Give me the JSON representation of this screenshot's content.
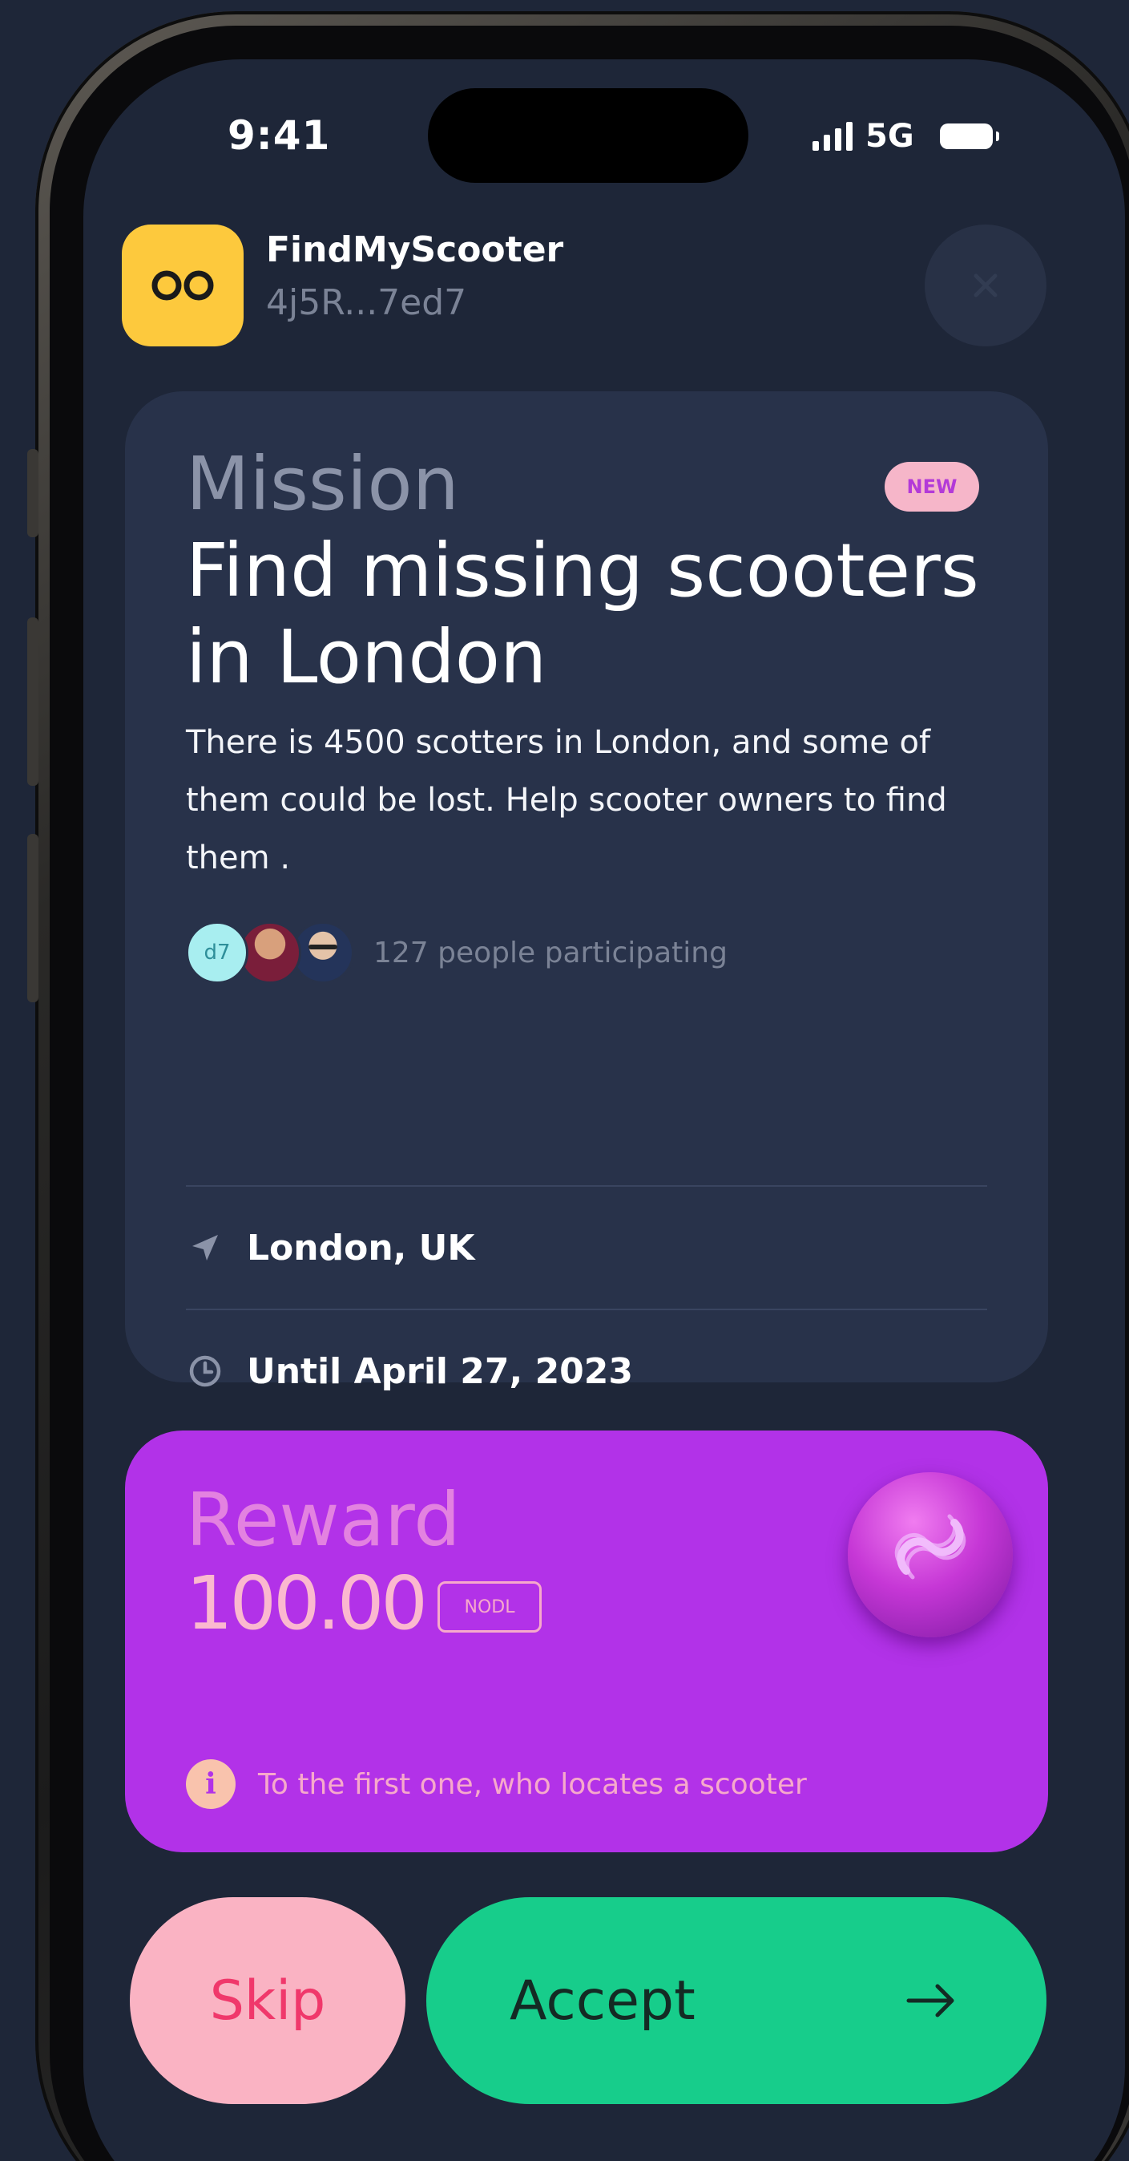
{
  "status_bar": {
    "time": "9:41",
    "network": "5G",
    "signal_icon": "cellular-signal-icon",
    "battery_icon": "battery-icon"
  },
  "app": {
    "name": "FindMyScooter",
    "address": "4j5R...7ed7",
    "logo_icon": "infinity-icon",
    "close_icon": "close-icon"
  },
  "mission": {
    "label": "Mission",
    "badge": "NEW",
    "title": "Find missing scooters in London",
    "description": "There is 4500 scotters in London, and some of them could be lost. Help scooter owners to find them .",
    "participants": {
      "avatars": [
        {
          "initials": "d7",
          "color": "#a8eef0"
        },
        {
          "initials": "",
          "color": "#7a1e3a"
        },
        {
          "initials": "",
          "color": "#24345a"
        }
      ],
      "text": "127 people participating"
    },
    "location": {
      "icon": "location-arrow-icon",
      "text": "London, UK"
    },
    "deadline": {
      "icon": "clock-icon",
      "text": "Until April 27, 2023"
    }
  },
  "reward": {
    "label": "Reward",
    "amount": "100.00",
    "token": "NODL",
    "coin_icon": "nodle-token-icon",
    "note_icon": "info-icon",
    "note": "To the first one, who locates a scooter"
  },
  "actions": {
    "skip_label": "Skip",
    "accept_label": "Accept",
    "accept_icon": "arrow-right-icon"
  },
  "colors": {
    "background": "#1e2638",
    "card": "#28324a",
    "reward": "#b232e8",
    "accept": "#17cd8b",
    "skip": "#fab3c3",
    "logo": "#fdc93d"
  }
}
